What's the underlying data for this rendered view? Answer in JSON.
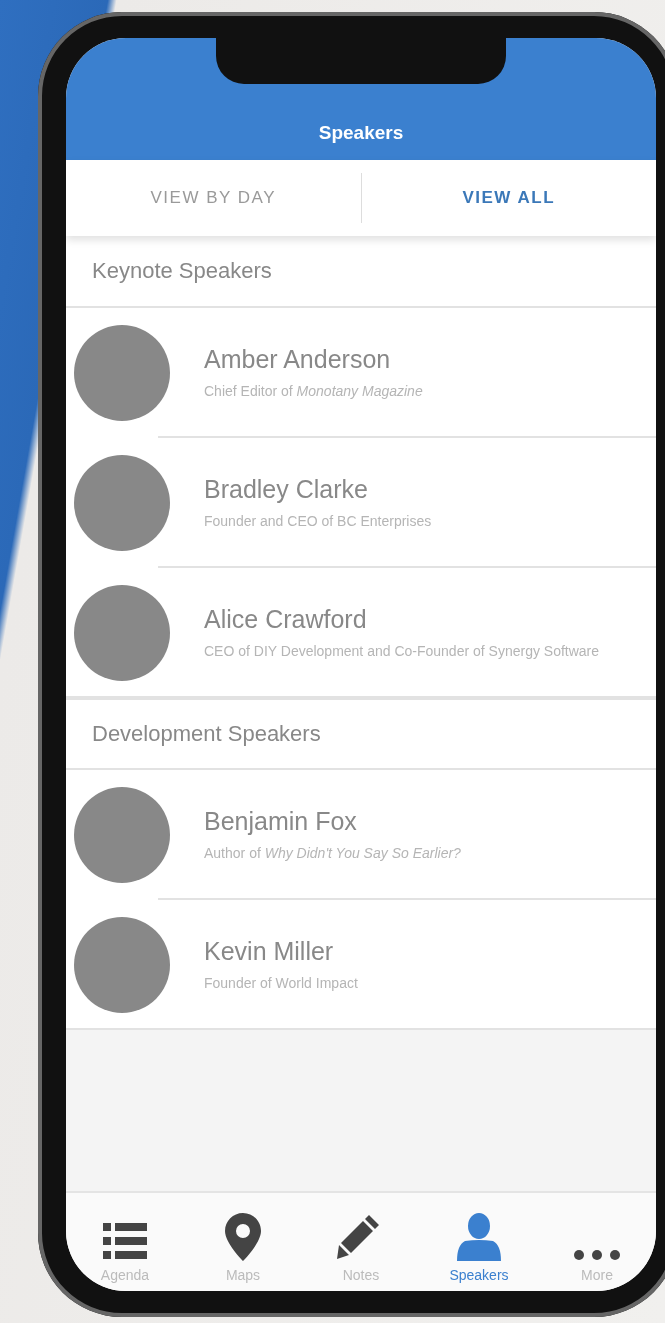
{
  "header": {
    "title": "Speakers"
  },
  "view_tabs": [
    {
      "label": "VIEW BY DAY",
      "selected": false
    },
    {
      "label": "VIEW ALL",
      "selected": true
    }
  ],
  "sections": [
    {
      "title": "Keynote Speakers",
      "speakers": [
        {
          "name": "Amber Anderson",
          "role": "Chief Editor of *Monotany Magazine*"
        },
        {
          "name": "Bradley Clarke",
          "role": "Founder and CEO of BC Enterprises"
        },
        {
          "name": "Alice Crawford",
          "role": "CEO of DIY Development and Co-Founder of Synergy Software"
        }
      ]
    },
    {
      "title": "Development Speakers",
      "speakers": [
        {
          "name": "Benjamin Fox",
          "role": "Author of *Why Didn't You Say So Earlier?*"
        },
        {
          "name": "Kevin Miller",
          "role": "Founder of World Impact"
        }
      ]
    }
  ],
  "tab_bar": [
    {
      "kind": "list",
      "label": "Agenda",
      "selected": false
    },
    {
      "kind": "pin",
      "label": "Maps",
      "selected": false
    },
    {
      "kind": "pencil",
      "label": "Notes",
      "selected": false
    },
    {
      "kind": "person",
      "label": "Speakers",
      "selected": true
    },
    {
      "kind": "dots",
      "label": "More",
      "selected": false
    }
  ]
}
